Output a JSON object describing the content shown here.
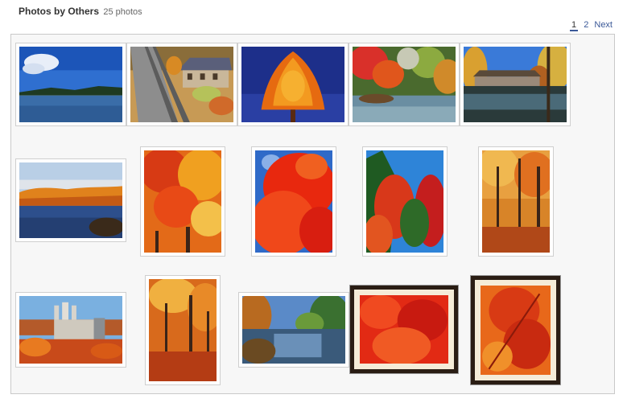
{
  "header": {
    "title": "Photos by Others",
    "count": "25 photos"
  },
  "pager": {
    "pages": [
      "1",
      "2"
    ],
    "current": "1",
    "next_label": "Next"
  },
  "photos": [
    {
      "name": "photo-lake-blue-sky",
      "scene": "lake with blue sky and clouds"
    },
    {
      "name": "photo-railroad-station",
      "scene": "railroad tracks and station house"
    },
    {
      "name": "photo-orange-tree",
      "scene": "orange tree against dark blue sky"
    },
    {
      "name": "photo-river-autumn",
      "scene": "river with autumn trees"
    },
    {
      "name": "photo-covered-bridge",
      "scene": "covered bridge over river"
    },
    {
      "name": "photo-lake-mist",
      "scene": "lake with misty autumn shoreline"
    },
    {
      "name": "photo-red-maple-1",
      "scene": "red and orange maple leaves"
    },
    {
      "name": "photo-red-maple-2",
      "scene": "red maple against blue sky"
    },
    {
      "name": "photo-forest-red",
      "scene": "red and green trees with blue sky"
    },
    {
      "name": "photo-forest-path",
      "scene": "forest with orange leaves on path"
    },
    {
      "name": "photo-cathedral",
      "scene": "town with cathedral and autumn hills"
    },
    {
      "name": "photo-forest-orange",
      "scene": "orange forest floor"
    },
    {
      "name": "photo-river-reflection",
      "scene": "river reflecting autumn trees"
    },
    {
      "name": "photo-red-leaves-framed",
      "scene": "red leaves in black frame"
    },
    {
      "name": "photo-sumac-framed",
      "scene": "red sumac leaves in black frame"
    }
  ]
}
